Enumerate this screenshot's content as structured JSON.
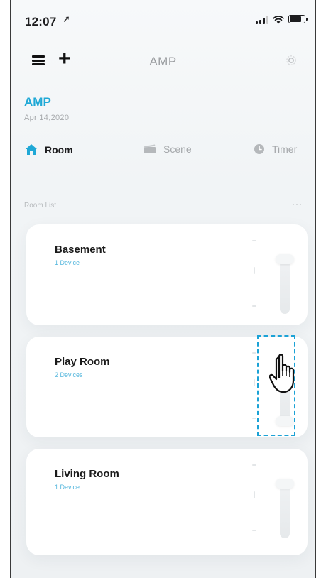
{
  "status_bar": {
    "time": "12:07",
    "location_glyph": "➚"
  },
  "nav": {
    "title": "AMP"
  },
  "header": {
    "title": "AMP",
    "date": "Apr 14,2020"
  },
  "tabs": [
    {
      "label": "Room",
      "icon": "home-icon",
      "active": true
    },
    {
      "label": "Scene",
      "icon": "scene-icon",
      "active": false
    },
    {
      "label": "Timer",
      "icon": "clock-icon",
      "active": false
    }
  ],
  "room_list": {
    "title": "Room List",
    "more": "···",
    "rooms": [
      {
        "name": "Basement",
        "devices": "1 Device",
        "level": 1.0
      },
      {
        "name": "Play Room",
        "devices": "2 Devices",
        "level": 0.0
      },
      {
        "name": "Living Room",
        "devices": "1 Device",
        "level": 1.0
      }
    ]
  },
  "colors": {
    "accent": "#1fa8d6",
    "highlight": "#1ba2d6",
    "device_count": "#55b7dd"
  }
}
